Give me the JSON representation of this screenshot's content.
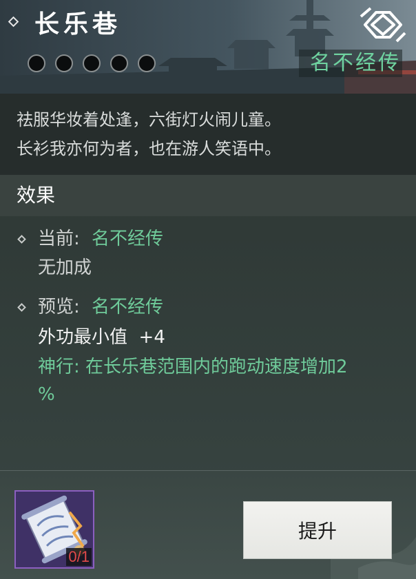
{
  "header": {
    "title": "长乐巷",
    "rank_label": "名不经传",
    "level_dots": 5,
    "emblem_icon": "knot-emblem-icon"
  },
  "poem": {
    "lines": [
      "祛服华妆着处逢，六街灯火闹儿童。",
      "长衫我亦何为者，也在游人笑语中。"
    ]
  },
  "effect": {
    "section_title": "效果",
    "current": {
      "label": "当前:",
      "rank": "名不经传",
      "detail": "无加成"
    },
    "preview": {
      "label": "预览:",
      "rank": "名不经传",
      "stat": "外功最小值  +4",
      "skill_line1": "神行: 在长乐巷范围内的跑动速度增加2",
      "skill_line2": "%"
    }
  },
  "footer": {
    "item_count": "0/1",
    "item_icon": "scroll-item-icon",
    "upgrade_label": "提升"
  },
  "colors": {
    "accent_green": "#6fcb9a",
    "count_red": "#e24a4a",
    "item_border": "#8c5fc0"
  }
}
